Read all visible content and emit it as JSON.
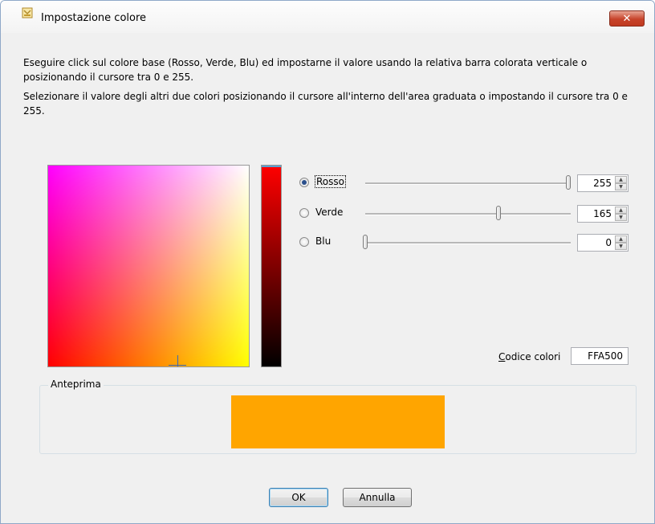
{
  "window": {
    "title": "Impostazione colore",
    "close_label": "✕"
  },
  "instructions": {
    "line1": "Eseguire click sul colore base (Rosso, Verde, Blu) ed impostarne il valore usando la relativa barra colorata verticale o posizionando il cursore tra 0 e 255.",
    "line2": "Selezionare il valore degli altri due colori posizionando il cursore all'interno dell'area graduata o impostando il cursore tra 0 e 255."
  },
  "channels": [
    {
      "label": "Rosso",
      "value": "255",
      "selected": true
    },
    {
      "label": "Verde",
      "value": "165",
      "selected": false
    },
    {
      "label": "Blu",
      "value": "0",
      "selected": false
    }
  ],
  "color_code": {
    "label_accesskey": "C",
    "label_rest": "odice colori",
    "value": "FFA500"
  },
  "preview": {
    "label": "Anteprima",
    "color": "#FFA500"
  },
  "buttons": {
    "ok": "OK",
    "cancel": "Annulla"
  },
  "icons": {
    "app": "palette-app-icon",
    "close": "close-icon",
    "spin_up": "spin-up-icon",
    "spin_down": "spin-down-icon"
  }
}
